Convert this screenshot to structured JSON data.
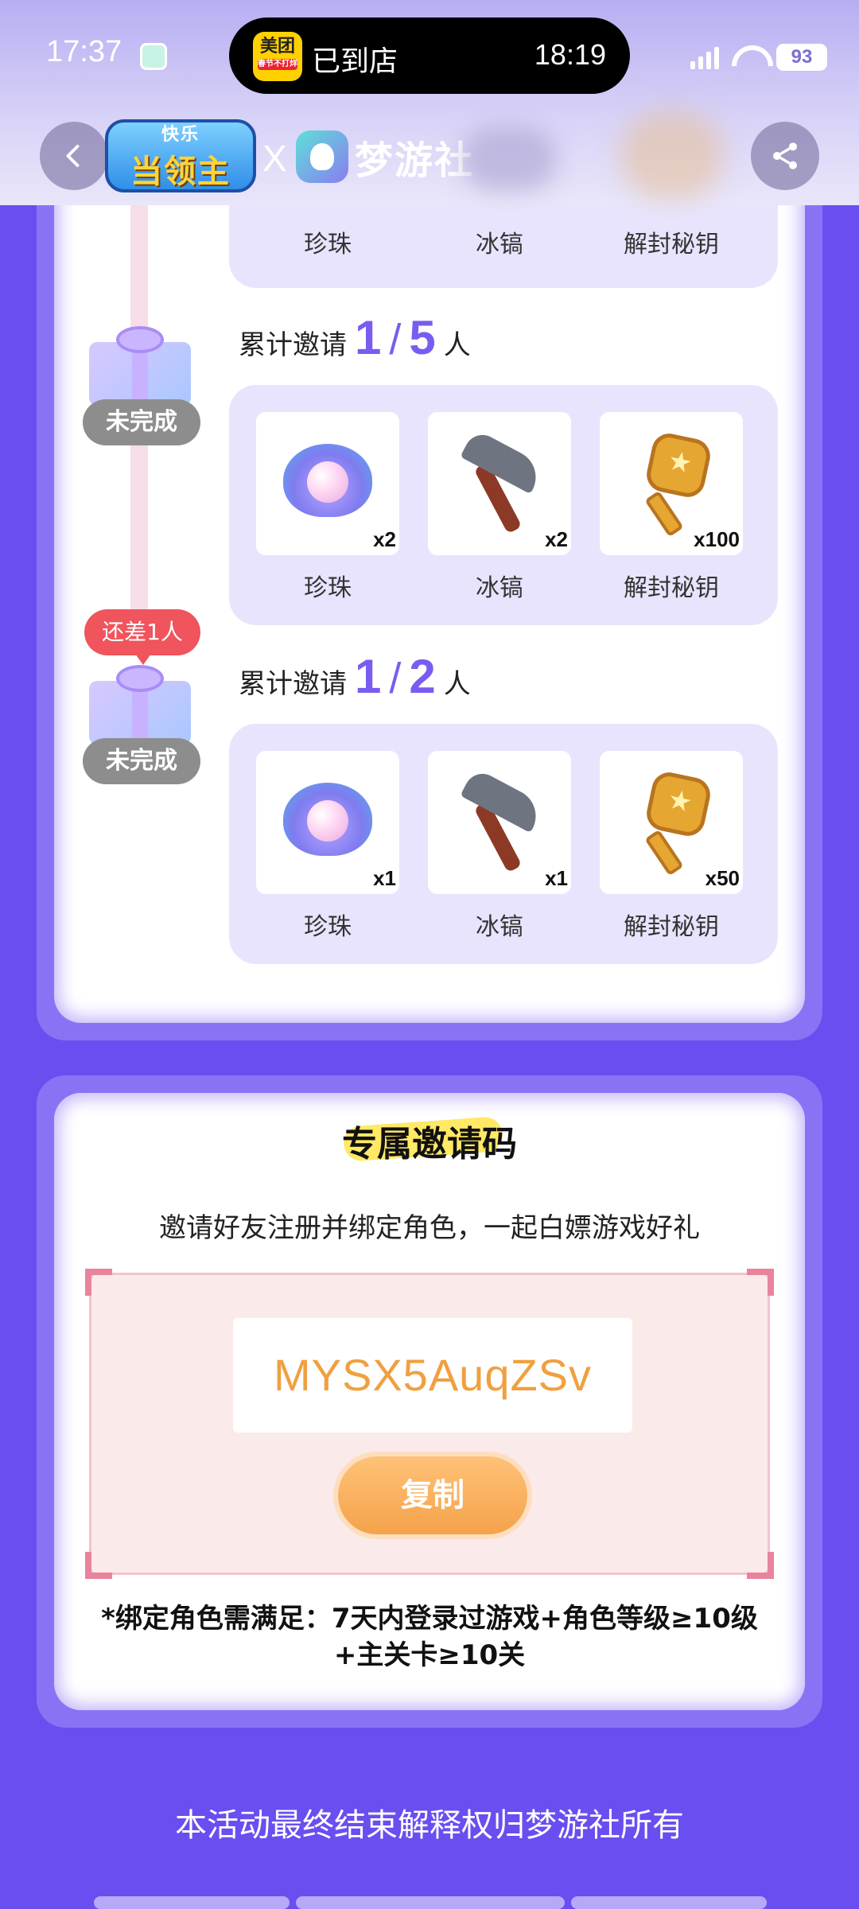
{
  "status_bar": {
    "time": "17:37",
    "island_app": "美团",
    "island_app_tag": "春节不打烊",
    "island_status": "已到店",
    "island_time": "18:19",
    "network": "4G",
    "battery": "93"
  },
  "header": {
    "game_logo_top": "快乐",
    "game_logo_main": "当领主",
    "x": "X",
    "brand_name": "梦游社"
  },
  "milestones": [
    {
      "state": "未完成",
      "need": "",
      "prefix": "累计邀请",
      "current": "1",
      "target": "5",
      "suffix": "人",
      "rewards": [
        {
          "name": "珍珠",
          "qty": "x2",
          "icon": "pearl-icon"
        },
        {
          "name": "冰镐",
          "qty": "x2",
          "icon": "pickaxe-icon"
        },
        {
          "name": "解封秘钥",
          "qty": "x100",
          "icon": "key-icon"
        }
      ]
    },
    {
      "state": "未完成",
      "need": "还差1人",
      "prefix": "累计邀请",
      "current": "1",
      "target": "2",
      "suffix": "人",
      "rewards": [
        {
          "name": "珍珠",
          "qty": "x1",
          "icon": "pearl-icon"
        },
        {
          "name": "冰镐",
          "qty": "x1",
          "icon": "pickaxe-icon"
        },
        {
          "name": "解封秘钥",
          "qty": "x50",
          "icon": "key-icon"
        }
      ]
    }
  ],
  "partial_rewards": [
    "珍珠",
    "冰镐",
    "解封秘钥"
  ],
  "invite": {
    "title": "专属邀请码",
    "subtitle": "邀请好友注册并绑定角色，一起白嫖游戏好礼",
    "code": "MYSX5AuqZSv",
    "copy_label": "复制",
    "note": "*绑定角色需满足：7天内登录过游戏+角色等级≥10级+主关卡≥10关"
  },
  "footer": "本活动最终结束解释权归梦游社所有",
  "colors": {
    "page_bg": "#6a4ef0",
    "accent_number": "#7a5cf0",
    "code_text": "#f0a040",
    "copy_button": "#f5a24a",
    "need_badge": "#f0545c"
  }
}
